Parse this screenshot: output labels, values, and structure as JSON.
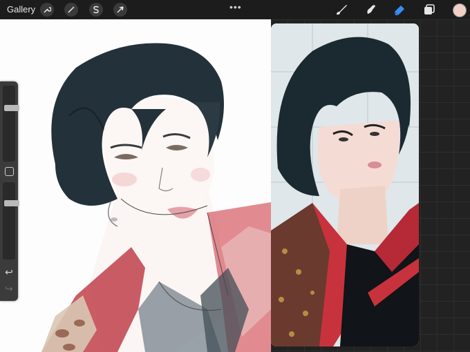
{
  "toolbar": {
    "gallery_label": "Gallery",
    "left_tools": [
      {
        "name": "wrench-icon"
      },
      {
        "name": "magic-wand-icon"
      },
      {
        "name": "selection-s-icon"
      },
      {
        "name": "transform-arrow-icon"
      }
    ],
    "more_dots": "•••",
    "right_tools": [
      {
        "name": "brush-icon"
      },
      {
        "name": "smudge-icon"
      },
      {
        "name": "eraser-icon",
        "active_color": "#3a8cf5"
      },
      {
        "name": "layers-icon"
      }
    ],
    "current_color": "#f2cfc4"
  },
  "sidebar": {
    "undo_symbol": "↩",
    "redo_symbol": "↪",
    "brush_size_level": 0.72,
    "opacity_level": 0.75
  },
  "colors": {
    "hair": "#1f2a30",
    "skin": "#fbf3f0",
    "blush": "#f1c2c4",
    "lips": "#dfa2a8",
    "jacket_red": "#c8323d",
    "wall_tile": "#e5ecee"
  }
}
